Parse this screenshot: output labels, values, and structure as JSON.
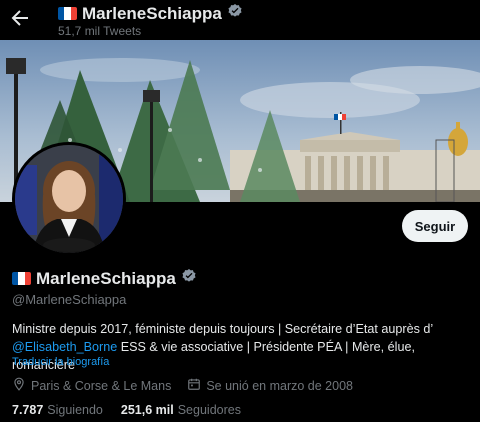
{
  "header": {
    "title": "MarleneSchiappa",
    "tweet_count": "51,7 mil Tweets"
  },
  "profile": {
    "display_name": "MarleneSchiappa",
    "handle": "@MarleneSchiappa",
    "follow_label": "Seguir",
    "bio_line1": "Ministre depuis 2017, féministe depuis toujours | Secrétaire d’Etat auprès d’",
    "bio_mention": "@Elisabeth_Borne",
    "bio_line2_rest": " ESS & vie associative | Présidente PÉA | Mère, élue, romancière",
    "translate_label": "Traducir la biografía",
    "location": "Paris & Corse & Le Mans",
    "joined": "Se unió en marzo de 2008",
    "following_count": "7.787",
    "following_label": "Siguiendo",
    "followers_count": "251,6 mil",
    "followers_label": "Seguidores"
  },
  "icons": {
    "back": "arrow-left-icon",
    "verified": "verified-badge-icon",
    "flag": "france-flag-icon",
    "location": "location-pin-icon",
    "calendar": "calendar-icon"
  },
  "colors": {
    "background": "#000000",
    "text": "#e7e9ea",
    "muted": "#71767b",
    "link": "#1d9bf0",
    "follow_button": "#eff3f4"
  }
}
